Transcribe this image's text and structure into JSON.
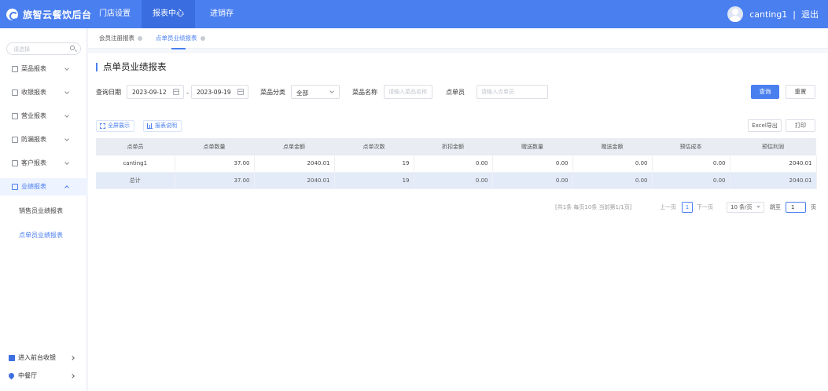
{
  "brand": {
    "title": "旅智云餐饮后台"
  },
  "topnav": [
    {
      "label": "门店设置"
    },
    {
      "label": "报表中心"
    },
    {
      "label": "进销存"
    }
  ],
  "user": {
    "name": "canting1",
    "separator": "|",
    "logout": "退出"
  },
  "sidebar": {
    "search_placeholder": "请选择",
    "menu": [
      {
        "label": "菜品报表",
        "icon": "dish-report-icon"
      },
      {
        "label": "收银报表",
        "icon": "cashier-report-icon"
      },
      {
        "label": "营业报表",
        "icon": "business-report-icon"
      },
      {
        "label": "防漏报表",
        "icon": "leak-report-icon"
      },
      {
        "label": "客户报表",
        "icon": "customer-report-icon"
      },
      {
        "label": "业绩报表",
        "icon": "performance-report-icon"
      }
    ],
    "sub_items": [
      {
        "label": "销售员业绩报表"
      },
      {
        "label": "点单员业绩报表"
      }
    ],
    "bottom": [
      {
        "label": "进入前台收银",
        "icon": "cashier-entry-icon"
      },
      {
        "label": "中餐厅",
        "icon": "location-pin-icon"
      }
    ]
  },
  "tabs": [
    {
      "label": "会员注册报表"
    },
    {
      "label": "点单员业绩报表"
    }
  ],
  "page": {
    "title": "点单员业绩报表"
  },
  "filters": {
    "date_label": "查询日期",
    "date_start": "2023-09-12",
    "date_sep": "-",
    "date_end": "2023-09-19",
    "category_label": "菜品分类",
    "category_value": "全部",
    "name_label": "菜品名称",
    "name_placeholder": "请输入菜品名称",
    "clerk_label": "点单员",
    "clerk_placeholder": "请输入点单员",
    "query_button": "查询",
    "reset_button": "重置"
  },
  "toolbar": {
    "fullscreen": "全屏展示",
    "report_desc": "报表说明",
    "excel_export": "Excel导出",
    "print": "打印"
  },
  "table": {
    "columns": [
      "点单员",
      "点单数量",
      "点单金额",
      "点单次数",
      "折扣金额",
      "赠送数量",
      "赠送金额",
      "预估成本",
      "预估利润"
    ],
    "rows": [
      [
        "canting1",
        "37.00",
        "2040.01",
        "19",
        "0.00",
        "0.00",
        "0.00",
        "0.00",
        "2040.01"
      ]
    ],
    "total": [
      "总计",
      "37.00",
      "2040.01",
      "19",
      "0.00",
      "0.00",
      "0.00",
      "0.00",
      "2040.01"
    ]
  },
  "pagination": {
    "summary": "[共1条 每页10条 当前第1/1页]",
    "prev": "上一页",
    "current": "1",
    "next": "下一页",
    "page_size": "10 条/页",
    "jump_label": "跳至",
    "jump_value": "1",
    "page_suffix": "页"
  },
  "colors": {
    "primary": "#4a7ff0",
    "header_bg": "#4a7ff0",
    "total_row_bg": "#e3ebf9"
  }
}
